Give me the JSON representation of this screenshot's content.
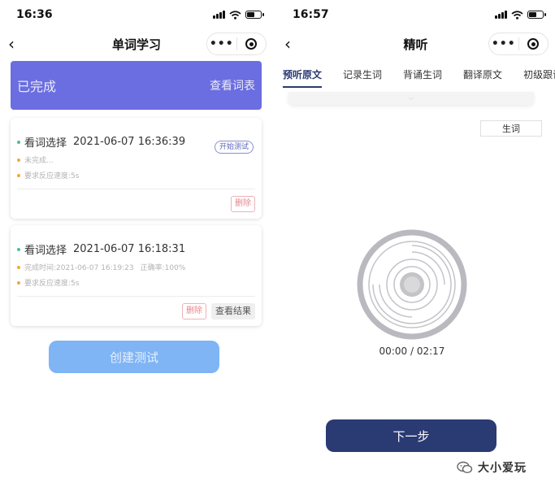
{
  "left": {
    "status_time": "16:36",
    "nav_title": "单词学习",
    "nav_more": "•••",
    "banner": {
      "status": "已完成",
      "link": "查看词表"
    },
    "card1": {
      "type": "看词选择",
      "datetime": "2021-06-07 16:36:39",
      "line1": "未完成...",
      "line2": "要求反应速度:5s",
      "start_label": "开始测试",
      "delete_label": "删除"
    },
    "card2": {
      "type": "看词选择",
      "datetime": "2021-06-07 16:18:31",
      "line1_time": "完成时间:2021-06-07 16:19:23",
      "line1_accuracy": "正确率:100%",
      "line2": "要求反应速度:5s",
      "delete_label": "删除",
      "result_label": "查看结果"
    },
    "create_label": "创建测试"
  },
  "right": {
    "status_time": "16:57",
    "nav_title": "精听",
    "nav_more": "•••",
    "tabs": [
      "预听原文",
      "记录生词",
      "背诵生词",
      "翻译原文",
      "初级跟读"
    ],
    "active_tab": 0,
    "word_button": "生词",
    "time_current": "00:00",
    "time_sep": "/",
    "time_total": "02:17",
    "next_label": "下一步",
    "watermark": "大小爱玩"
  },
  "colors": {
    "banner": "#6b6ee0",
    "create_button": "#7fb4f5",
    "next_button": "#2a3a73",
    "delete_red": "#e8858c",
    "dot_green": "#4cc08a",
    "dot_orange": "#f1a83a"
  },
  "icons": [
    "chevron-left-icon",
    "more-dots-icon",
    "target-circle-icon",
    "signal-icon",
    "wifi-icon",
    "battery-icon",
    "chevron-down-icon",
    "audio-disc-icon",
    "wechat-icon"
  ]
}
